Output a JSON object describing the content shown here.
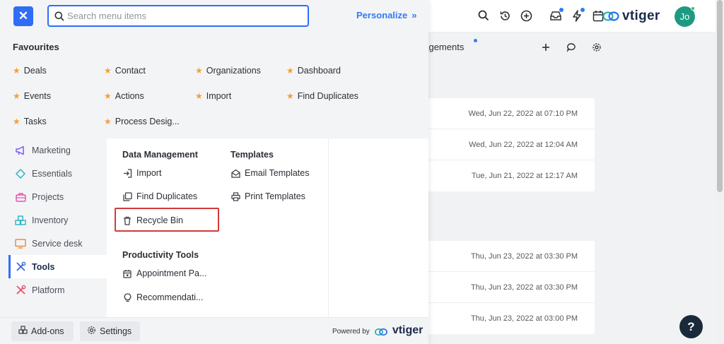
{
  "header": {
    "brand": "vtiger",
    "avatar_initials": "Jo",
    "icons": [
      "search-icon",
      "history-icon",
      "add-circle-icon",
      "inbox-icon",
      "bolt-icon",
      "calendar-icon"
    ]
  },
  "sub_header": {
    "title": "gagements",
    "icons": [
      "add-icon",
      "comment-icon",
      "gear-icon"
    ]
  },
  "cards": [
    {
      "rows": [
        "Wed, Jun 22, 2022 at 07:10 PM",
        "Wed, Jun 22, 2022 at 12:04 AM",
        "Tue, Jun 21, 2022 at 12:17 AM"
      ]
    },
    {
      "rows": [
        "Thu, Jun 23, 2022 at 03:30 PM",
        "Thu, Jun 23, 2022 at 03:30 PM",
        "Thu, Jun 23, 2022 at 03:00 PM"
      ]
    }
  ],
  "menu": {
    "search_placeholder": "Search menu items",
    "personalize": "Personalize",
    "favourites_title": "Favourites",
    "favourites": [
      "Deals",
      "Contact",
      "Organizations",
      "Dashboard",
      "Events",
      "Actions",
      "Import",
      "Find Duplicates",
      "Tasks",
      "Process Desig..."
    ],
    "categories": [
      "Marketing",
      "Essentials",
      "Projects",
      "Inventory",
      "Service desk",
      "Tools",
      "Platform"
    ],
    "active_category": "Tools",
    "data_management": {
      "title": "Data Management",
      "items": [
        "Import",
        "Find Duplicates",
        "Recycle Bin"
      ]
    },
    "templates": {
      "title": "Templates",
      "items": [
        "Email Templates",
        "Print Templates"
      ]
    },
    "productivity": {
      "title": "Productivity Tools",
      "items": [
        "Appointment Pa...",
        "Recommendati..."
      ]
    },
    "footer": {
      "addons": "Add-ons",
      "settings": "Settings",
      "powered_by": "Powered by",
      "brand": "vtiger"
    }
  },
  "colors": {
    "accent": "#2f6df6",
    "star": "#f49e3a",
    "highlight": "#d23a3a",
    "avatar": "#1f9a82"
  }
}
